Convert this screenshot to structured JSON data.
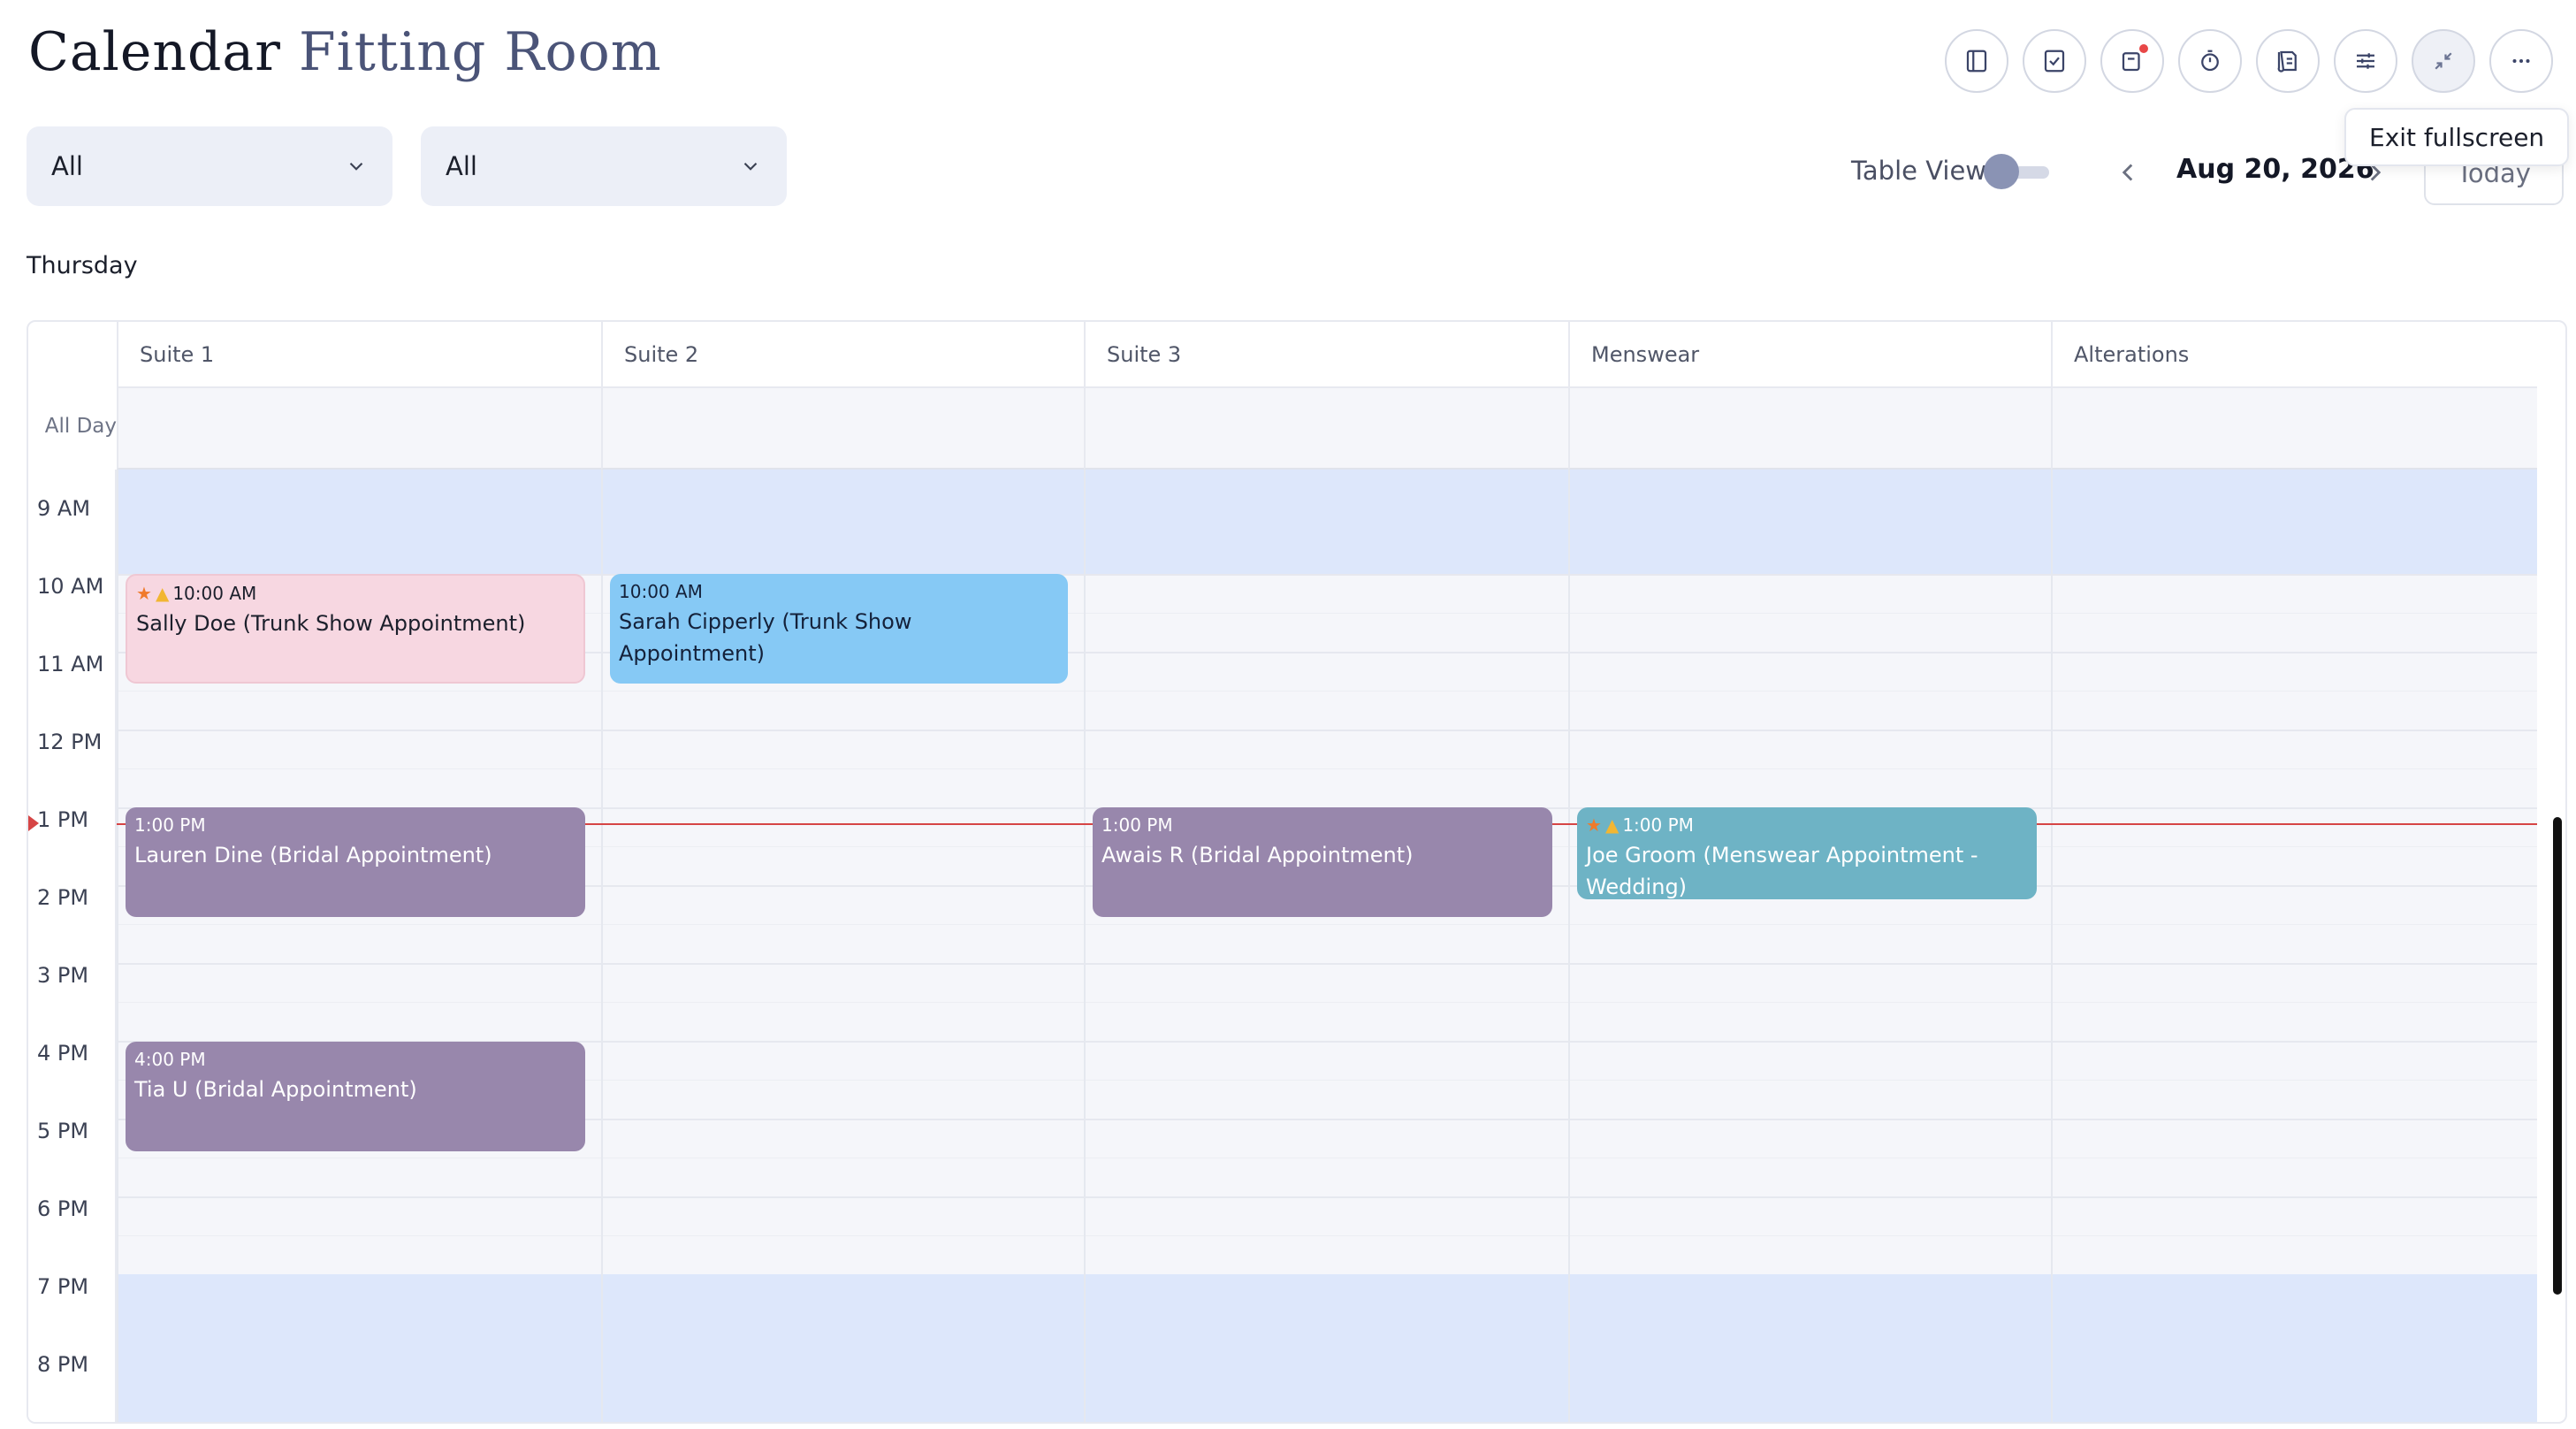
{
  "header": {
    "title_main": "Calendar",
    "title_sub": "Fitting Room",
    "toolbar_icons": [
      "sidebar-icon",
      "checkbox-icon",
      "notification-icon",
      "timer-icon",
      "notes-icon",
      "sliders-icon",
      "exit-fullscreen-icon",
      "more-icon"
    ],
    "tooltip": "Exit fullscreen"
  },
  "filters": {
    "first": "All",
    "second": "All"
  },
  "view": {
    "table_view_label": "Table View",
    "date": "Aug 20, 2026",
    "today_label": "Today",
    "day_name": "Thursday"
  },
  "columns": [
    "Suite 1",
    "Suite 2",
    "Suite 3",
    "Menswear",
    "Alterations"
  ],
  "all_day_label": "All Day",
  "hours": [
    "9 AM",
    "10 AM",
    "11 AM",
    "12 PM",
    "1 PM",
    "2 PM",
    "3 PM",
    "4 PM",
    "5 PM",
    "6 PM",
    "7 PM",
    "8 PM"
  ],
  "events": [
    {
      "time": "10:00 AM",
      "title": "Sally Doe (Trunk Show Appointment)",
      "column": "Suite 1",
      "badges": [
        "star",
        "thumbs-up"
      ],
      "color": "#f7d7e1"
    },
    {
      "time": "10:00 AM",
      "title": "Sarah Cipperly (Trunk Show Appointment)",
      "column": "Suite 2",
      "badges": [],
      "color": "#86c9f5"
    },
    {
      "time": "1:00 PM",
      "title": "Lauren Dine (Bridal Appointment)",
      "column": "Suite 1",
      "badges": [],
      "color": "#9887ac"
    },
    {
      "time": "1:00 PM",
      "title": "Awais R (Bridal Appointment)",
      "column": "Suite 3",
      "badges": [],
      "color": "#9887ac"
    },
    {
      "time": "1:00 PM",
      "title": "Joe Groom (Menswear Appointment - Wedding)",
      "column": "Menswear",
      "badges": [
        "star",
        "thumbs-up"
      ],
      "color": "#6eb3c5"
    },
    {
      "time": "4:00 PM",
      "title": "Tia U (Bridal Appointment)",
      "column": "Suite 1",
      "badges": [],
      "color": "#9887ac"
    }
  ],
  "colors": {
    "accent": "#4b5478",
    "off_hours": "#dde7fb",
    "now_line": "#d64545"
  }
}
